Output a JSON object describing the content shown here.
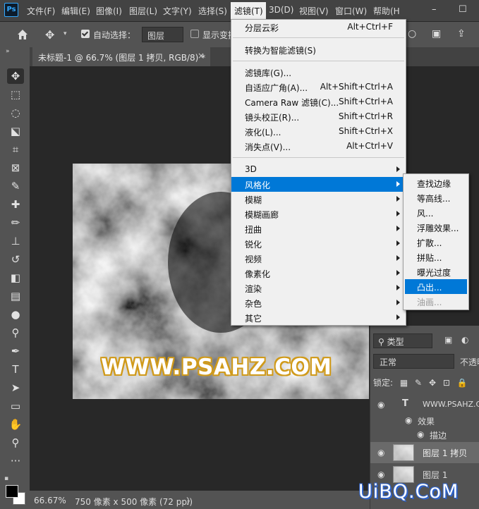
{
  "app": {
    "logo": "Ps"
  },
  "menubar": {
    "items": [
      "文件(F)",
      "编辑(E)",
      "图像(I)",
      "图层(L)",
      "文字(Y)",
      "选择(S)",
      "滤镜(T)",
      "3D(D)",
      "视图(V)",
      "窗口(W)",
      "帮助(H"
    ],
    "window_buttons": [
      "–",
      "☐"
    ]
  },
  "options_bar": {
    "auto_select_label": "自动选择：",
    "auto_select_checked": true,
    "layer_dropdown": "图层",
    "show_transform_label": "显示变换",
    "show_transform_checked": false
  },
  "document_tab": {
    "label": "未标题-1 @ 66.7% (图层 1 拷贝, RGB/8) *",
    "close": "×"
  },
  "canvas": {
    "watermark_text": "WWW.PSAHZ.COM"
  },
  "status_bar": {
    "zoom": "66.67%",
    "doc_size": "750 像素 x 500 像素 (72 ppi)",
    "arrow": "〉"
  },
  "filter_menu": {
    "items": [
      {
        "label": "分层云彩",
        "shortcut": "Alt+Ctrl+F"
      },
      {
        "label": "转换为智能滤镜(S)",
        "shortcut": ""
      },
      {
        "label": "滤镜库(G)...",
        "shortcut": ""
      },
      {
        "label": "自适应广角(A)...",
        "shortcut": "Alt+Shift+Ctrl+A"
      },
      {
        "label": "Camera Raw 滤镜(C)...",
        "shortcut": "Shift+Ctrl+A"
      },
      {
        "label": "镜头校正(R)...",
        "shortcut": "Shift+Ctrl+R"
      },
      {
        "label": "液化(L)...",
        "shortcut": "Shift+Ctrl+X"
      },
      {
        "label": "消失点(V)...",
        "shortcut": "Alt+Ctrl+V"
      },
      {
        "label": "3D",
        "shortcut": ""
      },
      {
        "label": "风格化",
        "shortcut": ""
      },
      {
        "label": "模糊",
        "shortcut": ""
      },
      {
        "label": "模糊画廊",
        "shortcut": ""
      },
      {
        "label": "扭曲",
        "shortcut": ""
      },
      {
        "label": "锐化",
        "shortcut": ""
      },
      {
        "label": "视频",
        "shortcut": ""
      },
      {
        "label": "像素化",
        "shortcut": ""
      },
      {
        "label": "渲染",
        "shortcut": ""
      },
      {
        "label": "杂色",
        "shortcut": ""
      },
      {
        "label": "其它",
        "shortcut": ""
      }
    ]
  },
  "stylize_menu": {
    "items": [
      "查找边缘",
      "等高线...",
      "风...",
      "浮雕效果...",
      "扩散...",
      "拼贴...",
      "曝光过度",
      "凸出...",
      "油画..."
    ],
    "highlighted": "凸出...",
    "disabled": "油画..."
  },
  "layers_panel": {
    "filter_label": "类型",
    "blend_mode": "正常",
    "opacity_label": "不透明",
    "lock_label": "锁定:",
    "layers": [
      {
        "name": "WWW.PSAHZ.COM",
        "kind": "text"
      },
      {
        "name": "效果",
        "kind": "effects"
      },
      {
        "name": "描边",
        "kind": "effect"
      },
      {
        "name": "图层 1 拷贝",
        "kind": "raster"
      },
      {
        "name": "图层 1",
        "kind": "raster"
      }
    ]
  },
  "site_watermark": "UiBQ.CoM",
  "colors": {
    "highlight": "#0078d7",
    "menu_bg": "#f0f0f0",
    "panel_bg": "#535353",
    "watermark_stroke": "#d09a1a"
  }
}
